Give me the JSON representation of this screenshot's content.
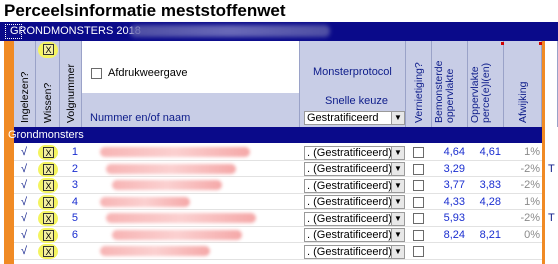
{
  "window": {
    "title": "Perceelsinformatie meststoffenwet"
  },
  "bar": {
    "label": "GRONDMONSTERS 2018"
  },
  "headers": {
    "ingelezen": "Ingelezen?",
    "wissen": "Wissen?",
    "wissen_btn": "X",
    "volgnummer": "Volgnummer",
    "afdruk": "Afdrukweergave",
    "nummer_naam": "Nummer en/of naam",
    "monsterprotocol": "Monsterprotocol",
    "snelle_keuze": "Snelle keuze",
    "snelle_keuze_value": "Gestratificeerd",
    "vernietiging": "Vernietiging?",
    "bemonsterde": "Bemonsterde oppervlakte",
    "oppervlakte": "Oppervlakte perce(e)l(en)",
    "afwijking": "Afwijking"
  },
  "section": {
    "label": "Grondmonsters"
  },
  "rows": [
    {
      "check": "√",
      "x": "X",
      "nr": "1",
      "protocol": ". (Gestratificeerd)",
      "bemonsterd": "4,64",
      "opp": "4,61",
      "afw": "1%",
      "extra": ""
    },
    {
      "check": "√",
      "x": "X",
      "nr": "2",
      "protocol": ". (Gestratificeerd)",
      "bemonsterd": "3,29",
      "opp": "",
      "afw": "-2%",
      "extra": "T"
    },
    {
      "check": "√",
      "x": "X",
      "nr": "3",
      "protocol": ". (Gestratificeerd)",
      "bemonsterd": "3,77",
      "opp": "3,83",
      "afw": "-2%",
      "extra": ""
    },
    {
      "check": "√",
      "x": "X",
      "nr": "4",
      "protocol": ". (Gestratificeerd)",
      "bemonsterd": "4,33",
      "opp": "4,28",
      "afw": "1%",
      "extra": ""
    },
    {
      "check": "√",
      "x": "X",
      "nr": "5",
      "protocol": ". (Gestratificeerd)",
      "bemonsterd": "5,93",
      "opp": "",
      "afw": "-2%",
      "extra": "T"
    },
    {
      "check": "√",
      "x": "X",
      "nr": "6",
      "protocol": ". (Gestratificeerd)",
      "bemonsterd": "8,24",
      "opp": "8,21",
      "afw": "0%",
      "extra": ""
    },
    {
      "check": "√",
      "x": "X",
      "nr": "",
      "protocol": ". (Gestratificeerd)",
      "bemonsterd": "",
      "opp": "",
      "afw": "",
      "extra": ""
    }
  ],
  "colors": {
    "navy": "#0a0a8a",
    "header": "#c8cde6",
    "orange": "#f08a24",
    "highlight": "#f4f460",
    "value_blue": "#1a2ed0"
  }
}
